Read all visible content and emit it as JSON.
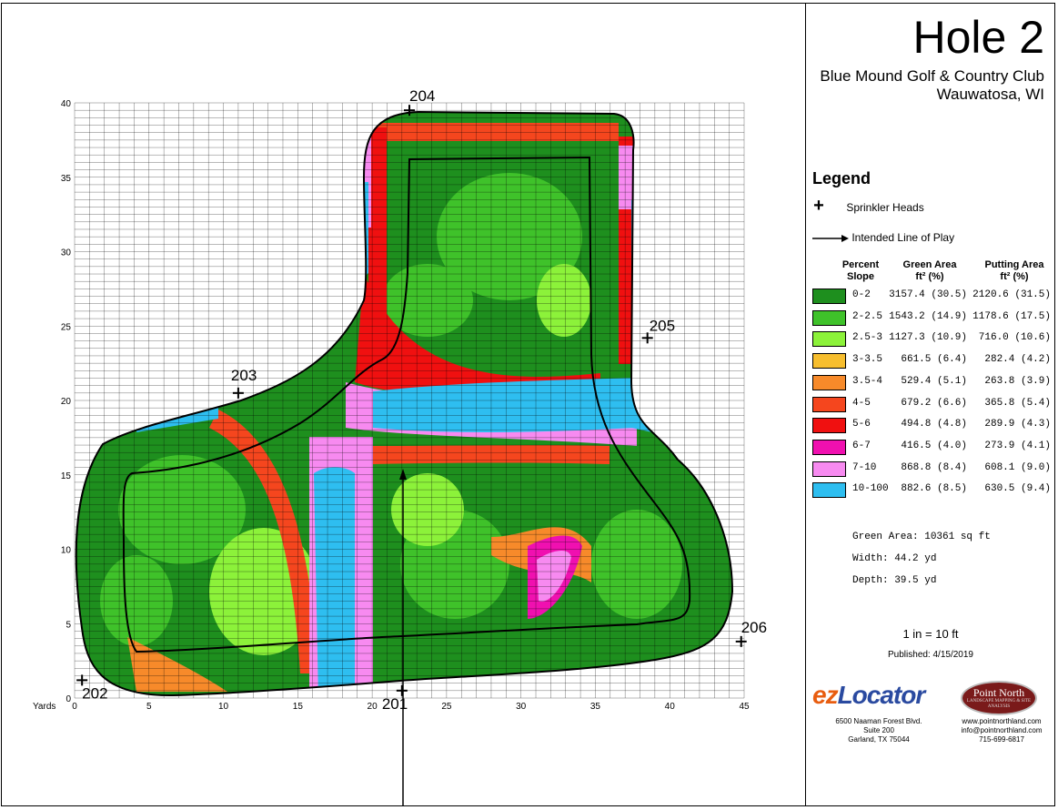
{
  "title": "Hole 2",
  "club": "Blue Mound Golf & Country Club",
  "city": "Wauwatosa, WI",
  "axis": {
    "x_label": "Yards",
    "x_ticks": [
      0,
      5,
      10,
      15,
      20,
      25,
      30,
      35,
      40,
      45
    ],
    "y_ticks": [
      0,
      5,
      10,
      15,
      20,
      25,
      30,
      35,
      40
    ],
    "x_max": 45,
    "y_max": 40
  },
  "sprinklers": [
    {
      "label": "201",
      "x": 22.0,
      "y": 0.5
    },
    {
      "label": "202",
      "x": 0.5,
      "y": 1.2
    },
    {
      "label": "203",
      "x": 11.0,
      "y": 20.5
    },
    {
      "label": "204",
      "x": 22.5,
      "y": 39.5
    },
    {
      "label": "205",
      "x": 38.5,
      "y": 24.2
    },
    {
      "label": "206",
      "x": 44.8,
      "y": 3.8
    }
  ],
  "legend": {
    "heading": "Legend",
    "sprinkler_label": "Sprinkler Heads",
    "line_label": "Intended Line of Play",
    "col_slope": [
      "Percent",
      "Slope"
    ],
    "col_green": [
      "Green Area",
      "ft² (%)"
    ],
    "col_putting": [
      "Putting Area",
      "ft² (%)"
    ],
    "rows": [
      {
        "slope": "0-2",
        "green": "3157.4 (30.5)",
        "putting": "2120.6 (31.5)",
        "color": "#1e8f1e"
      },
      {
        "slope": "2-2.5",
        "green": "1543.2 (14.9)",
        "putting": "1178.6 (17.5)",
        "color": "#3fc22a"
      },
      {
        "slope": "2.5-3",
        "green": "1127.3 (10.9)",
        "putting": "716.0 (10.6)",
        "color": "#8cf23a"
      },
      {
        "slope": "3-3.5",
        "green": "661.5 (6.4)",
        "putting": "282.4 (4.2)",
        "color": "#f7be2e"
      },
      {
        "slope": "3.5-4",
        "green": "529.4 (5.1)",
        "putting": "263.8 (3.9)",
        "color": "#f78a2a"
      },
      {
        "slope": "4-5",
        "green": "679.2 (6.6)",
        "putting": "365.8 (5.4)",
        "color": "#f5461e"
      },
      {
        "slope": "5-6",
        "green": "494.8 (4.8)",
        "putting": "289.9 (4.3)",
        "color": "#f01010"
      },
      {
        "slope": "6-7",
        "green": "416.5 (4.0)",
        "putting": "273.9 (4.1)",
        "color": "#f010b0"
      },
      {
        "slope": "7-10",
        "green": "868.8 (8.4)",
        "putting": "608.1 (9.0)",
        "color": "#f78af0"
      },
      {
        "slope": "10-100",
        "green": "882.6 (8.5)",
        "putting": "630.5 (9.4)",
        "color": "#2ebef0"
      }
    ]
  },
  "stats": {
    "green_area": "Green Area: 10361 sq ft",
    "width": "Width: 44.2 yd",
    "depth": "Depth: 39.5 yd"
  },
  "scale": "1 in = 10 ft",
  "published": "Published: 4/15/2019",
  "ezlocator": {
    "logo_e": "ez",
    "logo_rest": "Locator",
    "addr1": "6500 Naaman Forest Blvd.",
    "addr2": "Suite 200",
    "addr3": "Garland, TX  75044"
  },
  "pointnorth": {
    "logo": "Point North",
    "tagline": "LANDSCAPE MAPPING & SITE ANALYSIS",
    "web": "www.pointnorthland.com",
    "email": "info@pointnorthland.com",
    "phone": "715-699-6817"
  }
}
